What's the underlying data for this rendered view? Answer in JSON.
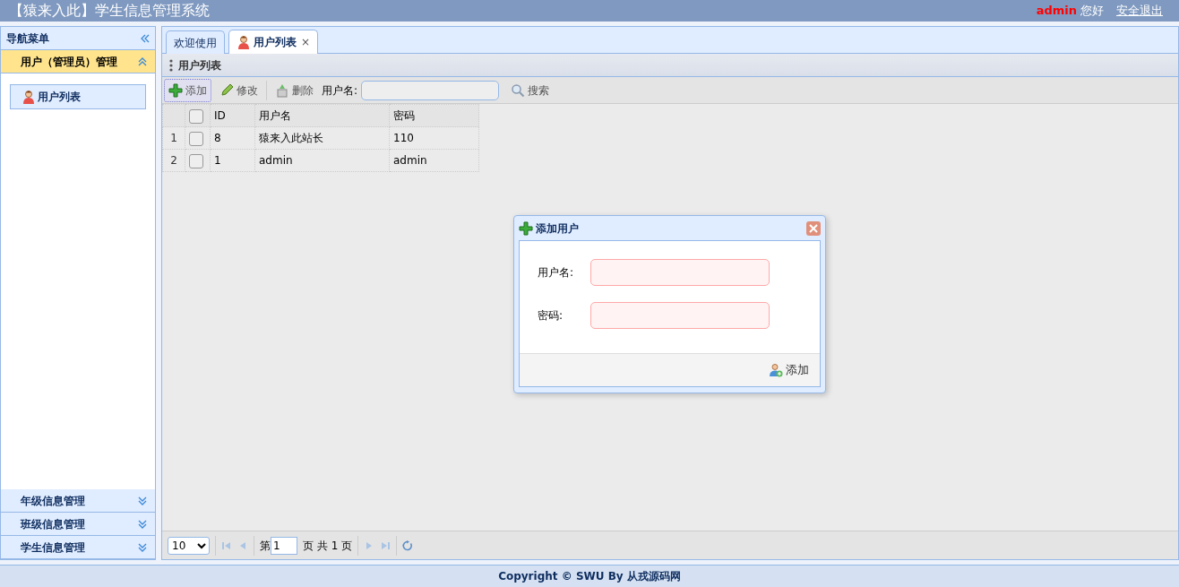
{
  "header": {
    "title": "【猿来入此】学生信息管理系统",
    "user": "admin",
    "greeting": "您好",
    "logout": "安全退出"
  },
  "sidebar": {
    "title": "导航菜单",
    "sections": [
      {
        "label": "用户（管理员）管理",
        "expanded": true,
        "items": [
          {
            "label": "用户列表",
            "selected": true
          }
        ]
      },
      {
        "label": "年级信息管理",
        "expanded": false
      },
      {
        "label": "班级信息管理",
        "expanded": false
      },
      {
        "label": "学生信息管理",
        "expanded": false
      }
    ]
  },
  "tabs": [
    {
      "label": "欢迎使用",
      "selected": false,
      "has_icon": false
    },
    {
      "label": "用户列表",
      "selected": true,
      "has_icon": true,
      "close": "×"
    }
  ],
  "panel": {
    "title": "用户列表"
  },
  "toolbar": {
    "buttons": [
      {
        "kind": "add",
        "label": "添加",
        "focused": true
      },
      {
        "kind": "edit",
        "label": "修改",
        "focused": false
      },
      {
        "kind": "delete",
        "label": "删除",
        "focused": false
      }
    ],
    "search_label": "用户名:",
    "search_button": "搜索"
  },
  "table": {
    "columns": [
      "ID",
      "用户名",
      "密码"
    ],
    "all_checked": false,
    "rows": [
      {
        "number": "1",
        "checked": false,
        "cells": [
          "8",
          "猿来入此站长",
          "110"
        ]
      },
      {
        "number": "2",
        "checked": false,
        "cells": [
          "1",
          "admin",
          "admin"
        ]
      }
    ]
  },
  "pager": {
    "page_size": "10",
    "page_prefix": "第",
    "page": "1",
    "page_suffix": "页 共 1 页"
  },
  "dialog": {
    "title": "添加用户",
    "fields": [
      {
        "label": "用户名:",
        "invalid": true
      },
      {
        "label": "密码:",
        "invalid": true
      }
    ],
    "button": "添加"
  },
  "footer": "Copyright © SWU By 从戎源码网"
}
